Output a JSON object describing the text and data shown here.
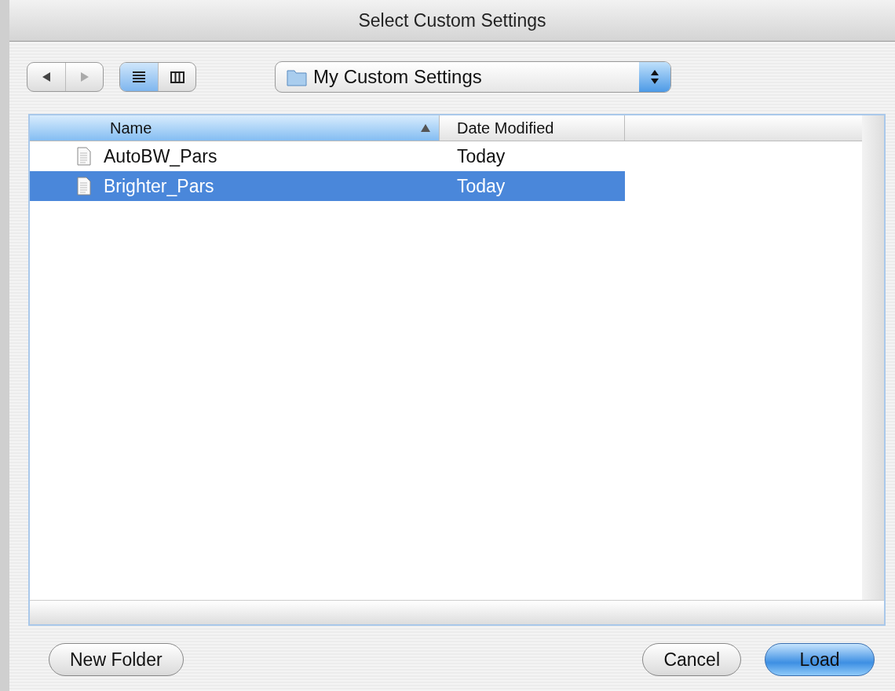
{
  "window": {
    "title": "Select Custom Settings"
  },
  "view_modes": [
    {
      "kind": "list",
      "selected": true
    },
    {
      "kind": "columns",
      "selected": false
    }
  ],
  "location": {
    "value": "My Custom Settings"
  },
  "table": {
    "columns": [
      {
        "label": "Name",
        "selected": true
      },
      {
        "label": "Date Modified",
        "selected": false
      }
    ],
    "rows": [
      {
        "name": "AutoBW_Pars",
        "date": "Today",
        "selected": false
      },
      {
        "name": "Brighter_Pars",
        "date": "Today",
        "selected": true
      }
    ]
  },
  "buttons": [
    {
      "label": "New Folder",
      "kind": "normal"
    },
    {
      "label": "Cancel",
      "kind": "normal"
    },
    {
      "label": "Load",
      "kind": "default"
    }
  ]
}
